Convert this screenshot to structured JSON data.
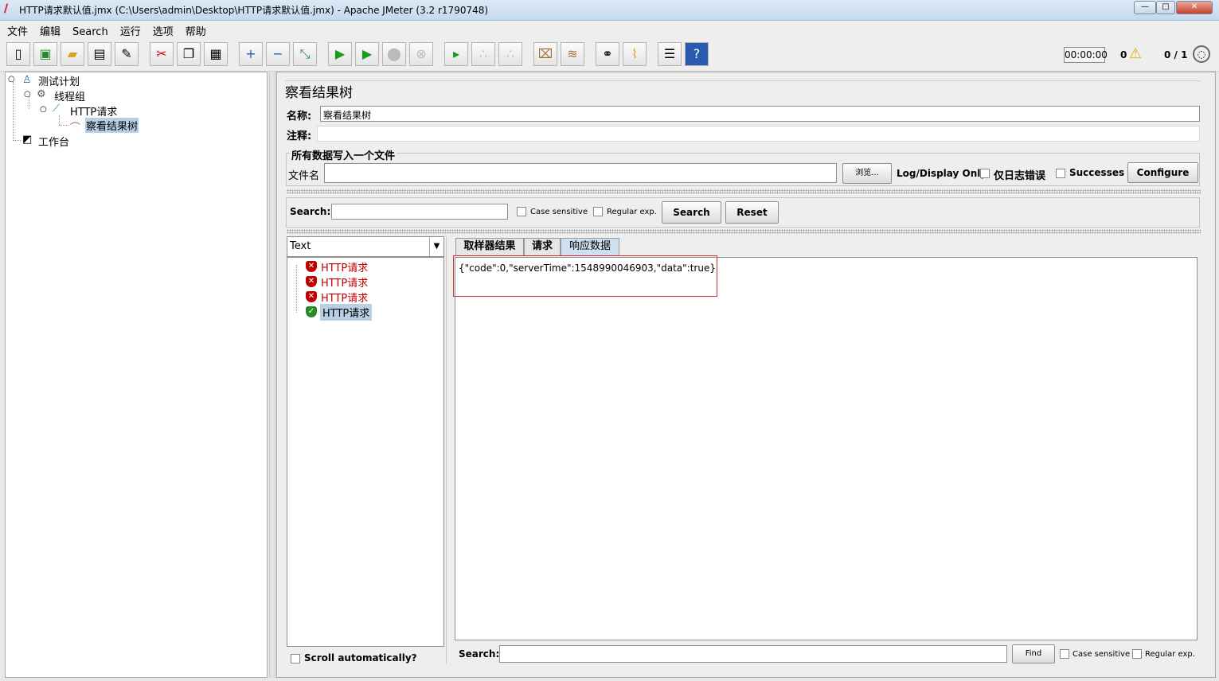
{
  "window": {
    "title": "HTTP请求默认值.jmx (C:\\Users\\admin\\Desktop\\HTTP请求默认值.jmx) - Apache JMeter (3.2 r1790748)",
    "controls": [
      "—",
      "□",
      "✕"
    ]
  },
  "menu": [
    "文件",
    "编辑",
    "Search",
    "运行",
    "选项",
    "帮助"
  ],
  "toolbar": {
    "timer": "00:00:00",
    "warnings": "0",
    "threads": "0 / 1"
  },
  "tree": {
    "plan": "测试计划",
    "thread_group": "线程组",
    "http_request": "HTTP请求",
    "listener": "察看结果树",
    "workbench": "工作台"
  },
  "panel": {
    "title": "察看结果树",
    "name_label": "名称:",
    "name_value": "察看结果树",
    "comment_label": "注释:",
    "comment_value": "",
    "file_group_title": "所有数据写入一个文件",
    "filename_label": "文件名",
    "filename_value": "",
    "browse": "浏览...",
    "log_display": "Log/Display Only:",
    "errors_only": "仅日志错误",
    "successes": "Successes",
    "configure": "Configure"
  },
  "search": {
    "label": "Search:",
    "value": "",
    "case_sensitive": "Case sensitive",
    "regex": "Regular exp.",
    "search_btn": "Search",
    "reset_btn": "Reset"
  },
  "results": {
    "renderer": "Text",
    "items": [
      {
        "label": "HTTP请求",
        "status": "error"
      },
      {
        "label": "HTTP请求",
        "status": "error"
      },
      {
        "label": "HTTP请求",
        "status": "error"
      },
      {
        "label": "HTTP请求",
        "status": "success"
      }
    ],
    "scroll_auto": "Scroll automatically?"
  },
  "tabs": [
    "取样器结果",
    "请求",
    "响应数据"
  ],
  "active_tab": "响应数据",
  "response_text": "{\"code\":0,\"serverTime\":1548990046903,\"data\":true}",
  "bottom_search": {
    "label": "Search:",
    "find": "Find",
    "case_sensitive": "Case sensitive",
    "regex": "Regular exp."
  },
  "colors": {
    "error": "#c00000",
    "success": "#2a8a2a",
    "highlight": "#d03030"
  }
}
